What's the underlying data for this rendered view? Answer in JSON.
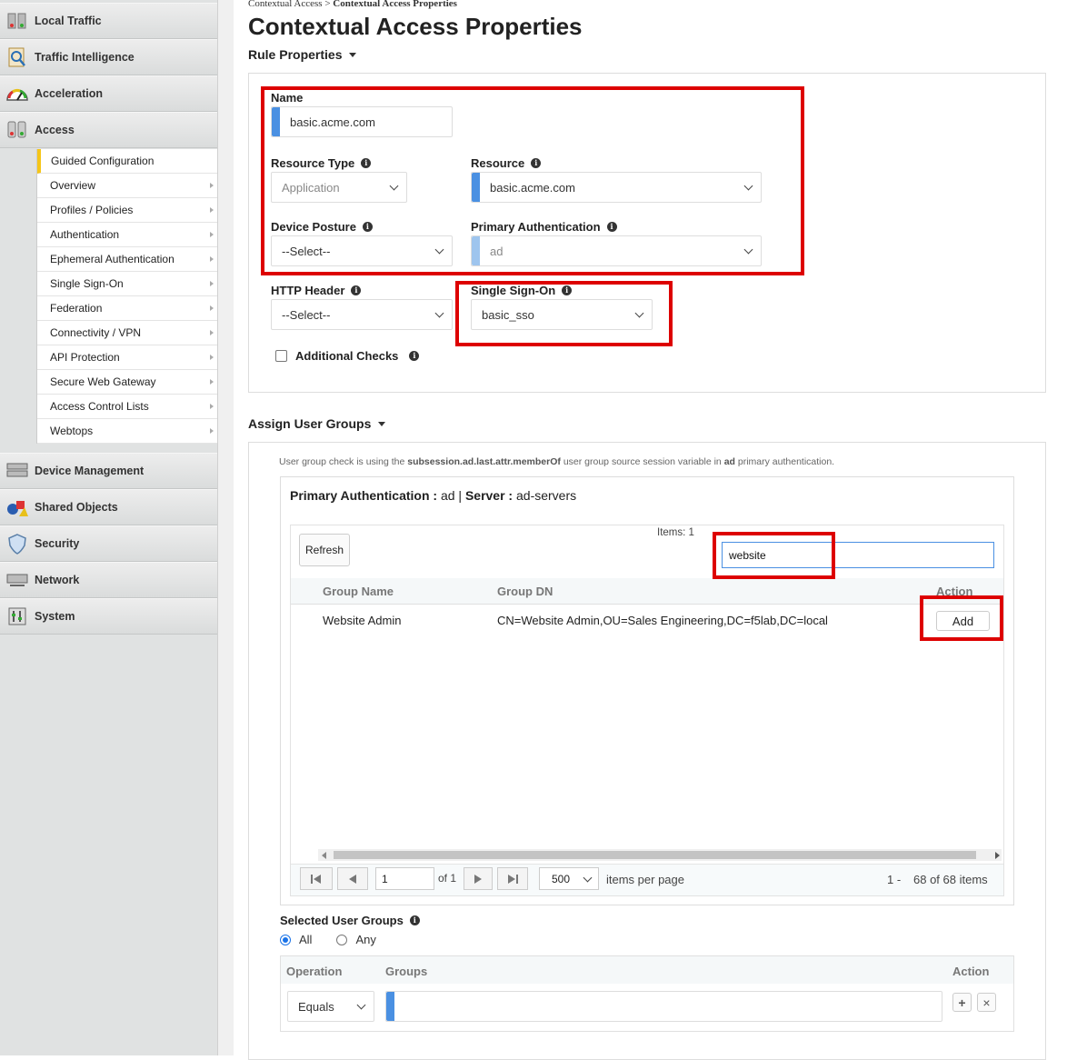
{
  "sidebar": {
    "top_items": [
      {
        "label": "Local Traffic",
        "icon": "local-traffic-icon"
      },
      {
        "label": "Traffic Intelligence",
        "icon": "traffic-intelligence-icon"
      },
      {
        "label": "Acceleration",
        "icon": "acceleration-gauge-icon"
      },
      {
        "label": "Access",
        "icon": "access-icon"
      }
    ],
    "access_submenu": [
      "Guided Configuration",
      "Overview",
      "Profiles / Policies",
      "Authentication",
      "Ephemeral Authentication",
      "Single Sign-On",
      "Federation",
      "Connectivity / VPN",
      "API Protection",
      "Secure Web Gateway",
      "Access Control Lists",
      "Webtops"
    ],
    "bottom_items": [
      {
        "label": "Device Management",
        "icon": "device-management-icon"
      },
      {
        "label": "Shared Objects",
        "icon": "shared-objects-icon"
      },
      {
        "label": "Security",
        "icon": "security-shield-icon"
      },
      {
        "label": "Network",
        "icon": "network-icon"
      },
      {
        "label": "System",
        "icon": "system-icon"
      }
    ]
  },
  "breadcrumb": {
    "parent": "Contextual Access",
    "sep": ">",
    "current": "Contextual Access Properties"
  },
  "page_title": "Contextual Access Properties",
  "rule_properties": {
    "section_label": "Rule Properties",
    "name_label": "Name",
    "name_value": "basic.acme.com",
    "resource_type_label": "Resource Type",
    "resource_type_value": "Application",
    "resource_label": "Resource",
    "resource_value": "basic.acme.com",
    "device_posture_label": "Device Posture",
    "device_posture_value": "--Select--",
    "primary_auth_label": "Primary Authentication",
    "primary_auth_value": "ad",
    "http_header_label": "HTTP Header",
    "http_header_value": "--Select--",
    "sso_label": "Single Sign-On",
    "sso_value": "basic_sso",
    "additional_checks_label": "Additional Checks"
  },
  "assign_user_groups": {
    "section_label": "Assign User Groups",
    "note_prefix": "User group check is using the",
    "note_var": "subsession.ad.last.attr.memberOf",
    "note_mid": "user group source session variable in",
    "note_ad": "ad",
    "note_suffix": "primary authentication.",
    "primary_auth_label": "Primary Authentication :",
    "primary_auth_value": "ad",
    "pipe": "|",
    "server_label": "Server :",
    "server_value": "ad-servers",
    "refresh_label": "Refresh",
    "items_count": "Items: 1",
    "search_value": "website",
    "columns": [
      "Group Name",
      "Group DN",
      "Action"
    ],
    "rows": [
      {
        "group_name": "Website Admin",
        "group_dn": "CN=Website Admin,OU=Sales Engineering,DC=f5lab,DC=local",
        "action": "Add"
      }
    ],
    "pager": {
      "page": "1",
      "of_label": "of 1",
      "per_page": "500",
      "per_page_label": "items per page",
      "range_start": "1 -",
      "range_label": "68 of 68 items"
    }
  },
  "selected_user_groups": {
    "label": "Selected User Groups",
    "radio_all": "All",
    "radio_any": "Any",
    "columns": [
      "Operation",
      "Groups",
      "Action"
    ],
    "operation_value": "Equals",
    "add_symbol": "+",
    "remove_symbol": "×"
  },
  "colors": {
    "highlight_red": "#dd0000",
    "required_blue": "#4a90e2",
    "active_yellow": "#f5c518"
  }
}
